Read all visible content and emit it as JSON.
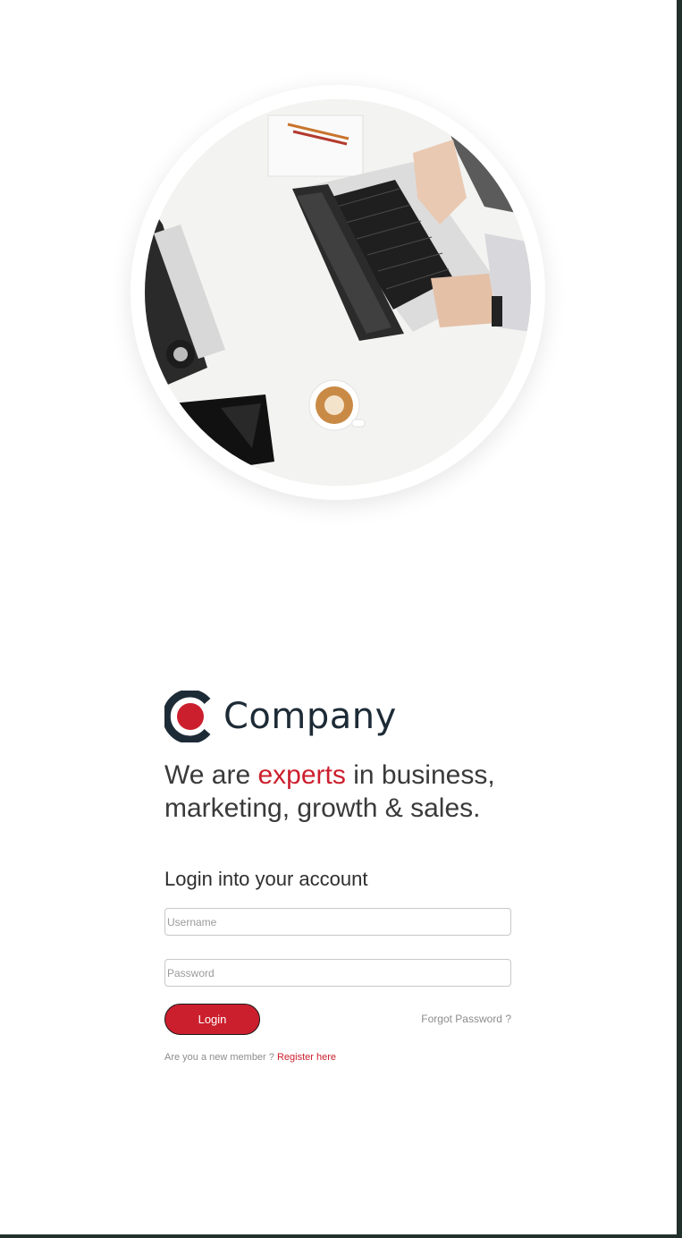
{
  "hero": {
    "image": "laptop-desk-photo"
  },
  "brand": {
    "name": "Company",
    "logo": "company-logo-icon"
  },
  "tagline": {
    "part1": "We are ",
    "accent": "experts",
    "part2": " in business, marketing, growth & sales."
  },
  "login": {
    "title": "Login into your account",
    "username_placeholder": "Username",
    "username_value": "",
    "password_placeholder": "Password",
    "password_value": "",
    "button_label": "Login",
    "forgot_label": "Forgot Password ?",
    "new_member_text": "Are you a new member ? ",
    "register_label": "Register here"
  },
  "colors": {
    "accent": "#cc1f2d",
    "brand_dark": "#1d2b36",
    "text": "#3a3a3a",
    "muted": "#8c8c8c",
    "frame": "#22302b"
  }
}
